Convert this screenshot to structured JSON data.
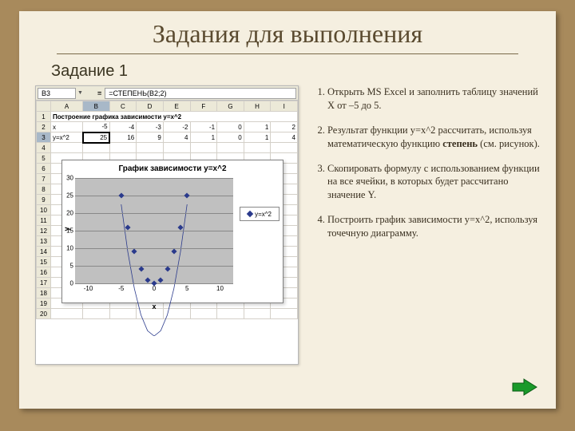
{
  "slide": {
    "title": "Задания для выполнения",
    "subtitle": "Задание 1"
  },
  "excel": {
    "cell_ref": "B3",
    "formula": "=СТЕПЕНЬ(B2;2)",
    "cols": [
      "A",
      "B",
      "C",
      "D",
      "E",
      "F",
      "G",
      "H",
      "I"
    ],
    "row1_title": "Построение графика зависимости y=x^2",
    "row2_label": "x",
    "row2": [
      "-5",
      "-4",
      "-3",
      "-2",
      "-1",
      "0",
      "1",
      "2"
    ],
    "row3_label": "y=x^2",
    "row3": [
      "25",
      "16",
      "9",
      "4",
      "1",
      "0",
      "1",
      "4"
    ],
    "blank_rows": [
      "4",
      "5",
      "6",
      "7",
      "8",
      "9",
      "10",
      "11",
      "12",
      "13",
      "14",
      "15",
      "16",
      "17",
      "18",
      "19",
      "20"
    ]
  },
  "chart_data": {
    "type": "scatter",
    "title": "График зависимости y=x^2",
    "xlabel": "x",
    "ylabel": "y",
    "x": [
      -10,
      -5,
      0,
      5,
      10
    ],
    "y_ticks": [
      0,
      5,
      10,
      15,
      20,
      25,
      30
    ],
    "xlim": [
      -12,
      12
    ],
    "ylim": [
      0,
      30
    ],
    "series": [
      {
        "name": "y=x^2",
        "x": [
          -5,
          -4,
          -3,
          -2,
          -1,
          0,
          1,
          2,
          3,
          4,
          5
        ],
        "y": [
          25,
          16,
          9,
          4,
          1,
          0,
          1,
          4,
          9,
          16,
          25
        ]
      }
    ],
    "legend_position": "right"
  },
  "steps": {
    "items": [
      {
        "text": "Открыть MS Excel и заполнить таблицу значений Х от –5 до 5."
      },
      {
        "pre": "Результат функции y=x^2 рассчитать, используя математическую функцию ",
        "bold": "степень",
        "post": " (см. рисунок)."
      },
      {
        "text": "Скопировать формулу с использованием функции на все ячейки, в которых будет рассчитано значение Y."
      },
      {
        "text": " Построить график зависимости y=x^2, используя точечную диаграмму."
      }
    ]
  },
  "nav": {
    "next": "next"
  }
}
